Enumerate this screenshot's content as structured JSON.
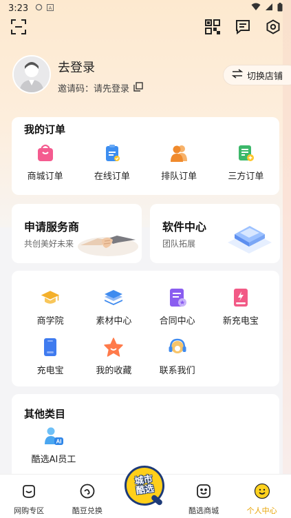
{
  "status_bar": {
    "time": "3:23",
    "icons": [
      "sync-icon",
      "a-icon",
      "wifi-icon",
      "signal-icon",
      "battery-icon"
    ]
  },
  "topbar": {
    "icons": [
      "scan-icon",
      "qrcode-icon",
      "message-icon",
      "settings-icon"
    ]
  },
  "profile": {
    "login_label": "去登录",
    "invite_label": "邀请码：请先登录",
    "switch_store_label": "切换店铺"
  },
  "orders": {
    "title": "我的订单",
    "items": [
      {
        "label": "商城订单",
        "icon": "shopping-bag-icon",
        "color": "#f45b8f"
      },
      {
        "label": "在线订单",
        "icon": "clipboard-check-icon",
        "color": "#3d8ef0"
      },
      {
        "label": "排队订单",
        "icon": "queue-people-icon",
        "color": "#f08a2c"
      },
      {
        "label": "三方订单",
        "icon": "third-party-order-icon",
        "color": "#3cb86a"
      }
    ]
  },
  "promos": [
    {
      "title": "申请服务商",
      "subtitle": "共创美好未来",
      "icon": "handshake-icon"
    },
    {
      "title": "软件中心",
      "subtitle": "团队拓展",
      "icon": "chip-icon"
    }
  ],
  "services": {
    "items": [
      {
        "label": "商学院",
        "icon": "graduation-cap-icon",
        "color": "#f4b02b"
      },
      {
        "label": "素材中心",
        "icon": "layers-icon",
        "color": "#3f8bef"
      },
      {
        "label": "合同中心",
        "icon": "contract-icon",
        "color": "#8a5df0"
      },
      {
        "label": "新充电宝",
        "icon": "power-bank-new-icon",
        "color": "#f25a86"
      },
      {
        "label": "充电宝",
        "icon": "power-bank-icon",
        "color": "#3f7bef"
      },
      {
        "label": "我的收藏",
        "icon": "star-icon",
        "color": "#ff7a4a"
      },
      {
        "label": "联系我们",
        "icon": "headset-icon",
        "color": "#f0a83a"
      }
    ]
  },
  "other": {
    "title": "其他类目",
    "items": [
      {
        "label": "酷选AI员工",
        "icon": "ai-staff-icon",
        "color": "#4aa6f0"
      }
    ]
  },
  "nav": {
    "items": [
      {
        "label": "网购专区",
        "icon": "bag-icon",
        "active": false
      },
      {
        "label": "酷豆兑换",
        "icon": "bean-icon",
        "active": false
      },
      {
        "label": "",
        "icon": "center-logo-icon",
        "active": false
      },
      {
        "label": "酷选商城",
        "icon": "smile-store-icon",
        "active": false
      },
      {
        "label": "个人中心",
        "icon": "profile-smile-icon",
        "active": true
      }
    ],
    "center_badge_text": [
      "城市",
      "酷选"
    ]
  },
  "colors": {
    "accent": "#e8a200",
    "background": "#f4f4f6",
    "card": "#ffffff"
  }
}
